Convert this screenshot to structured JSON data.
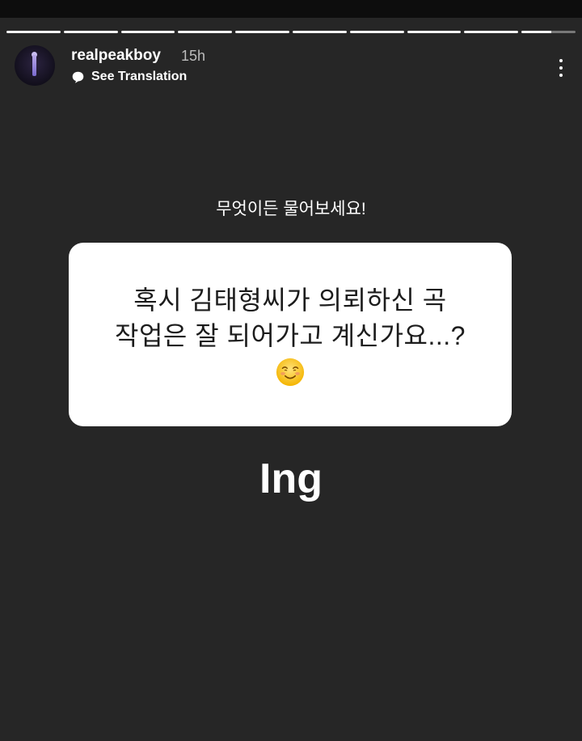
{
  "story": {
    "progress": {
      "segment_count": 10,
      "current_segment": 9,
      "current_fill": 0.55
    },
    "header": {
      "username": "realpeakboy",
      "time_ago": "15h",
      "translate_label": "See Translation"
    },
    "question_sticker": {
      "prompt": "무엇이든 물어보세요!",
      "question_lines": [
        "혹시 김태형씨가 의뢰하신 곡",
        "작업은 잘 되어가고 계신가요...?"
      ],
      "emoji": "smiling-face-icon"
    },
    "answer": "Ing"
  },
  "colors": {
    "background": "#262626",
    "card": "#ffffff",
    "text": "#ffffff",
    "muted_text": "#bdbdbd"
  }
}
